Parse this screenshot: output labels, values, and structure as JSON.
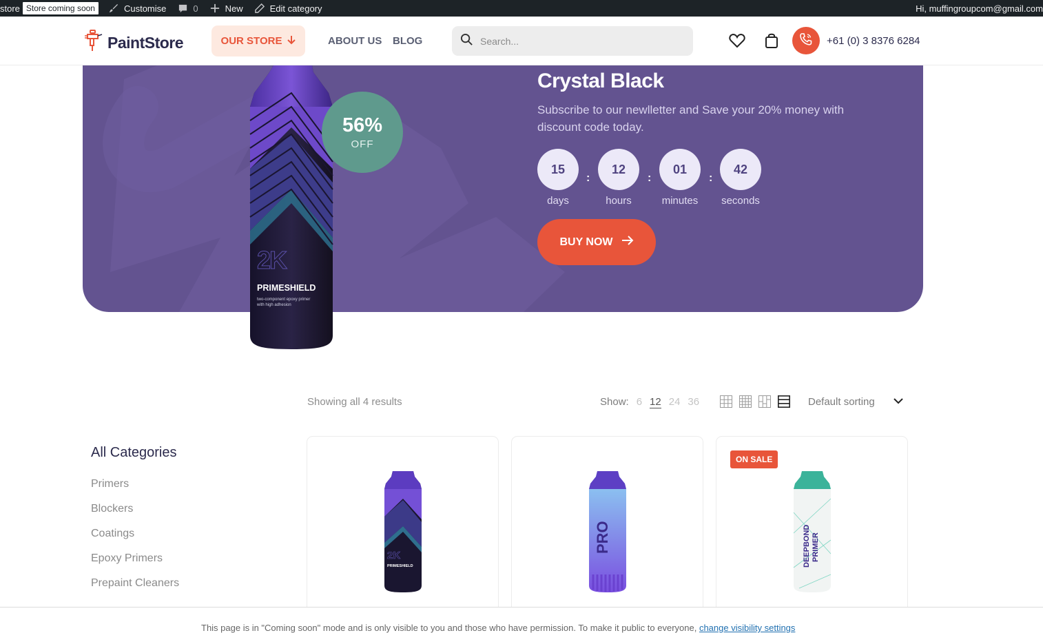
{
  "admin_bar": {
    "site": "store",
    "badge": "Store coming soon",
    "customise": "Customise",
    "comments_count": "0",
    "new": "New",
    "edit_category": "Edit category",
    "greeting": "Hi, muffingroupcom@gmail.com"
  },
  "header": {
    "logo": "PaintStore",
    "nav": {
      "store": "OUR STORE",
      "about": "ABOUT US",
      "blog": "BLOG"
    },
    "search_placeholder": "Search...",
    "phone": "+61 (0) 3 8376 6284"
  },
  "hero": {
    "discount_pct": "56%",
    "discount_off": "OFF",
    "bottle_brand": "2K",
    "bottle_name": "PRIMESHIELD",
    "bottle_desc_1": "two-component epoxy primer",
    "bottle_desc_2": "with high adhesion",
    "title": "Crystal Black",
    "subtitle": "Subscribe to our newlletter and Save your 20% money with discount code today.",
    "countdown": [
      {
        "value": "15",
        "label": "days"
      },
      {
        "value": "12",
        "label": "hours"
      },
      {
        "value": "01",
        "label": "minutes"
      },
      {
        "value": "42",
        "label": "seconds"
      }
    ],
    "separator": ":",
    "buy_label": "BUY NOW"
  },
  "shop": {
    "results": "Showing all 4 results",
    "show_label": "Show:",
    "show_options": [
      "6",
      "12",
      "24",
      "36"
    ],
    "show_selected": "12",
    "sorting": "Default sorting"
  },
  "sidebar": {
    "title": "All Categories",
    "categories": [
      "Primers",
      "Blockers",
      "Coatings",
      "Epoxy Primers",
      "Prepaint Cleaners"
    ]
  },
  "products": [
    {
      "badge": "",
      "label_1": "2K",
      "label_2": "PRIMESHIELD"
    },
    {
      "badge": "",
      "label_1": "PRO",
      "label_2": ""
    },
    {
      "badge": "ON SALE",
      "label_1": "DEEPBOND",
      "label_2": "PRIMER"
    }
  ],
  "notice": {
    "text": "This page is in \"Coming soon\" mode and is only visible to you and those who have permission. To make it public to everyone,",
    "link": "change visibility settings"
  },
  "colors": {
    "accent": "#e8553a",
    "hero_bg": "#635390",
    "discount": "#5f9a8d",
    "dark": "#2b2a4c"
  }
}
